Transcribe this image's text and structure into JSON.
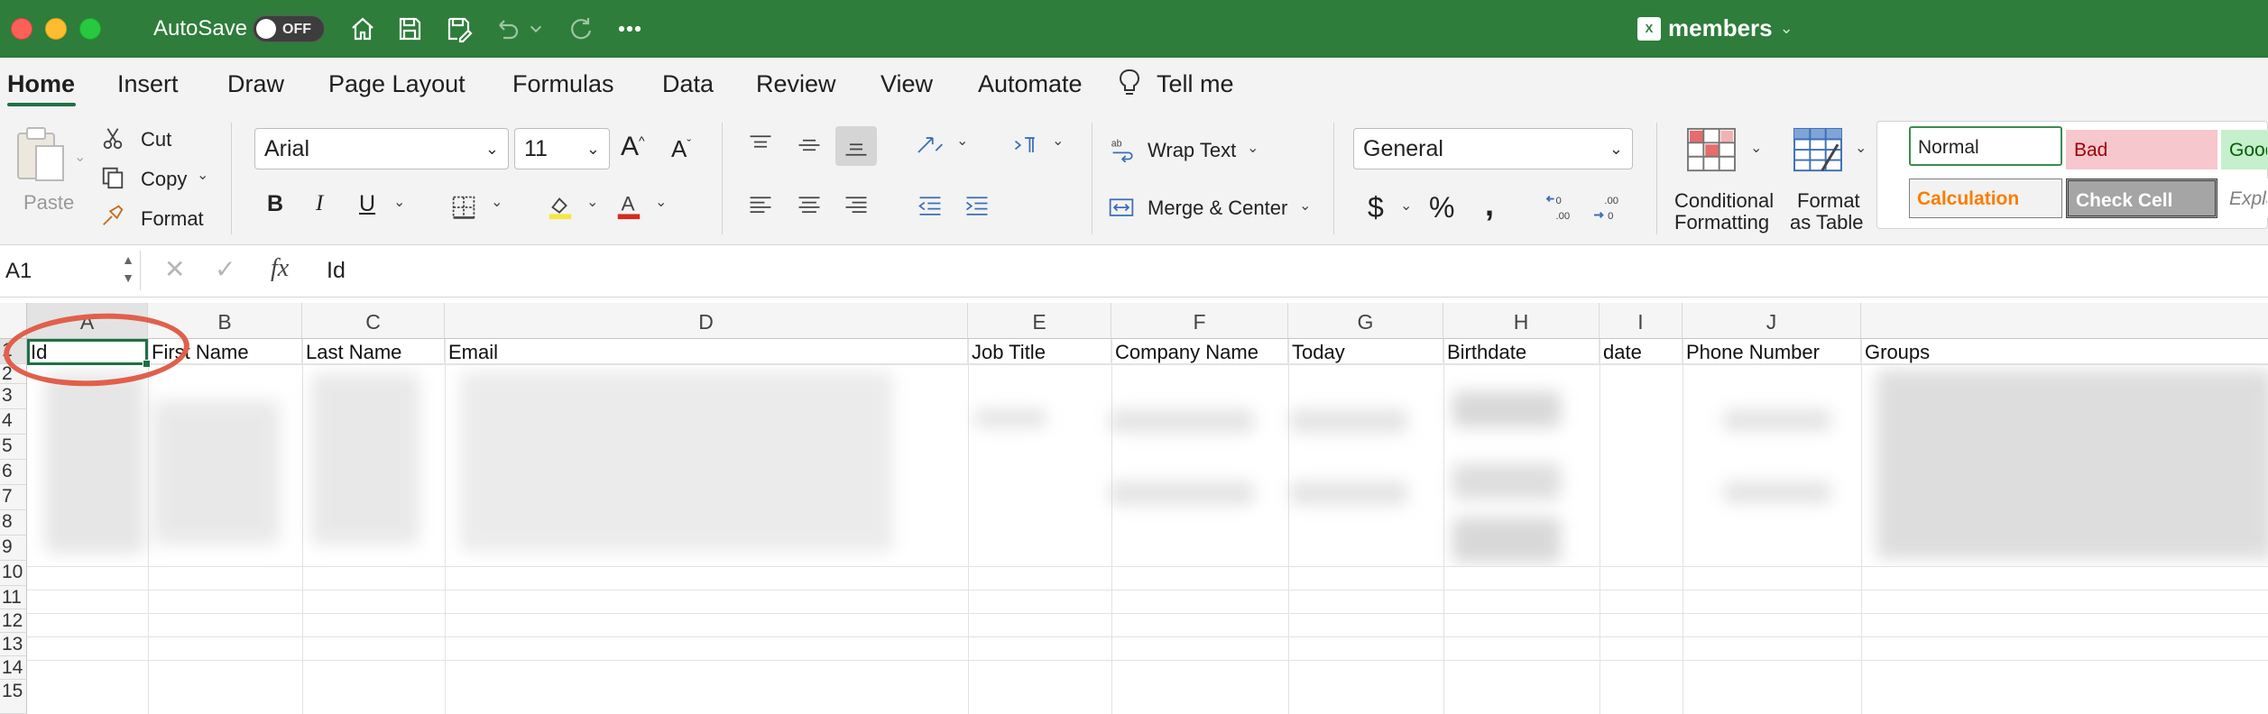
{
  "titlebar": {
    "autosave_label": "AutoSave",
    "autosave_state": "OFF",
    "document_title": "members",
    "file_icon_label": "xlsx"
  },
  "tabs": [
    "Home",
    "Insert",
    "Draw",
    "Page Layout",
    "Formulas",
    "Data",
    "Review",
    "View",
    "Automate"
  ],
  "tell_me": "Tell me",
  "ribbon": {
    "paste": "Paste",
    "cut": "Cut",
    "copy": "Copy",
    "format": "Format",
    "font_name": "Arial",
    "font_size": "11",
    "bold": "B",
    "italic": "I",
    "underline": "U",
    "wrap_text": "Wrap Text",
    "merge_center": "Merge & Center",
    "number_format": "General",
    "currency": "$",
    "percent": "%",
    "comma": ",",
    "conditional_formatting_1": "Conditional",
    "conditional_formatting_2": "Formatting",
    "format_table_1": "Format",
    "format_table_2": "as Table",
    "styles": {
      "normal": "Normal",
      "bad": "Bad",
      "good": "Good",
      "calculation": "Calculation",
      "check_cell": "Check Cell",
      "explanatory": "Explanatory"
    },
    "accent_colors": {
      "highlight": "#f5e642",
      "font_color": "#d62a1f"
    }
  },
  "formula_bar": {
    "cell_ref": "A1",
    "fx": "fx",
    "value": "Id"
  },
  "grid": {
    "columns": [
      "A",
      "B",
      "C",
      "D",
      "E",
      "F",
      "G",
      "H",
      "I",
      "J"
    ],
    "rows": [
      "1",
      "2",
      "3",
      "4",
      "5",
      "6",
      "7",
      "8",
      "9",
      "10",
      "11",
      "12",
      "13",
      "14",
      "15"
    ],
    "header_row": [
      "Id",
      "First Name",
      "Last Name",
      "Email",
      "Job Title",
      "Company Name",
      "Today",
      "Birthdate",
      "date",
      "Phone Number",
      "Groups"
    ],
    "selected_cell": "A1"
  },
  "colors": {
    "titlebar_bg": "#2e7d3a",
    "selection": "#1e7145",
    "annotation": "#e0604b"
  }
}
